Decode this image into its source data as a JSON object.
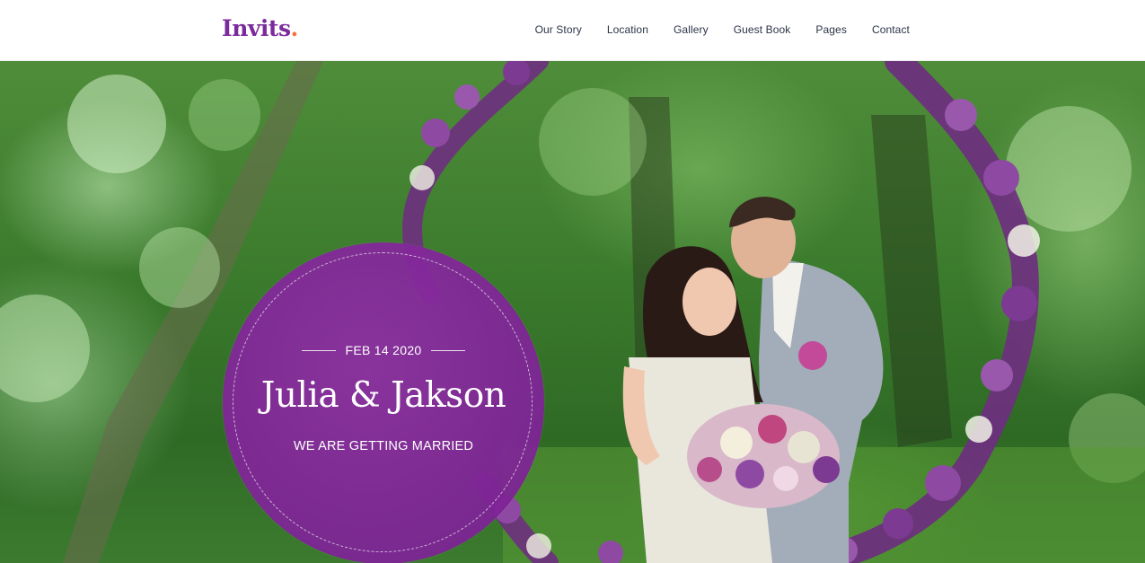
{
  "header": {
    "logo_text": "Invits",
    "logo_dot": ".",
    "nav": [
      "Our Story",
      "Location",
      "Gallery",
      "Guest Book",
      "Pages",
      "Contact"
    ]
  },
  "hero": {
    "date": "FEB 14 2020",
    "names": "Julia & Jakson",
    "tagline": "WE ARE GETTING MARRIED",
    "image": "wedding-couple-forest-photo"
  },
  "colors": {
    "brand_purple": "#7b2a9c",
    "logo_dot": "#ff6a3d",
    "badge_purple": "#8f2fa5",
    "nav_text": "#2b3447"
  }
}
